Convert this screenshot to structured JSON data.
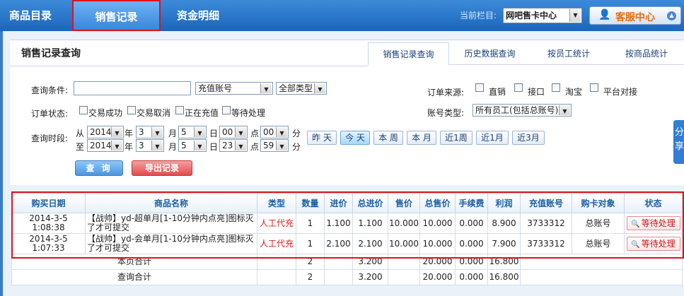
{
  "nav": {
    "items": [
      {
        "label": "商品目录",
        "active": false
      },
      {
        "label": "销售记录",
        "active": true
      },
      {
        "label": "资金明细",
        "active": false
      }
    ],
    "current_label": "当前栏目:",
    "current_value": "网吧售卡中心",
    "service_label": "客服中心"
  },
  "panel": {
    "title": "销售记录查询",
    "tabs": [
      {
        "label": "销售记录查询",
        "active": true
      },
      {
        "label": "历史数据查询",
        "active": false
      },
      {
        "label": "按员工统计",
        "active": false
      },
      {
        "label": "按商品统计",
        "active": false
      }
    ]
  },
  "filters": {
    "query_label": "查询条件:",
    "query_value": "",
    "account_type": "充值账号",
    "all_types": "全部类型",
    "order_source_label": "订单来源:",
    "order_sources": [
      "直销",
      "接口",
      "淘宝",
      "平台对接"
    ],
    "order_status_label": "订单状态:",
    "order_statuses": [
      "交易成功",
      "交易取消",
      "正在充值",
      "等待处理"
    ],
    "account_kind_label": "账号类型:",
    "account_kind_value": "所有员工(包括总账号)",
    "time_label": "查询时段:",
    "from": {
      "prefix": "从",
      "year": "2014",
      "month": "3",
      "day": "5",
      "hour": "00",
      "minute": "00"
    },
    "to": {
      "prefix": "至",
      "year": "2014",
      "month": "3",
      "day": "5",
      "hour": "23",
      "minute": "59"
    },
    "units": {
      "year": "年",
      "month": "月",
      "day": "日",
      "hour": "点",
      "minute": "分"
    },
    "quick_ranges": [
      {
        "label": "昨 天",
        "active": false
      },
      {
        "label": "今 天",
        "active": true
      },
      {
        "label": "本 周",
        "active": false
      },
      {
        "label": "本 月",
        "active": false
      },
      {
        "label": "近1周",
        "active": false
      },
      {
        "label": "近1月",
        "active": false
      },
      {
        "label": "近3月",
        "active": false
      }
    ],
    "query_button": "查 询",
    "export_button": "导出记录"
  },
  "share_tab": "分享",
  "table": {
    "headers": [
      "购买日期",
      "商品名称",
      "类型",
      "数量",
      "进价",
      "总进价",
      "售价",
      "总售价",
      "手续费",
      "利润",
      "充值账号",
      "购卡对象",
      "状态"
    ],
    "rows": [
      {
        "date": "2014-3-5 1:08:38",
        "name": "【战帅】yd-超单月[1-10分钟内点亮]图标灭了才可提交",
        "type": "人工代充",
        "qty": "1",
        "cost": "1.100",
        "total_cost": "1.100",
        "price": "10.000",
        "total_price": "10.000",
        "fee": "0.000",
        "profit": "8.900",
        "account": "3733312",
        "target": "总账号",
        "status": "等待处理"
      },
      {
        "date": "2014-3-5 1:07:33",
        "name": "【战帅】yd-会单月[1-10分钟内点亮]图标灭了才可提交",
        "type": "人工代充",
        "qty": "1",
        "cost": "2.100",
        "total_cost": "2.100",
        "price": "10.000",
        "total_price": "10.000",
        "fee": "0.000",
        "profit": "7.900",
        "account": "3733312",
        "target": "总账号",
        "status": "等待处理"
      }
    ],
    "summaries": [
      {
        "label": "本页合计",
        "qty": "2",
        "total_cost": "3.200",
        "total_price": "20.000",
        "fee": "0.000",
        "profit": "16.800"
      },
      {
        "label": "查询合计",
        "qty": "2",
        "total_cost": "3.200",
        "total_price": "20.000",
        "fee": "0.000",
        "profit": "16.800"
      }
    ]
  }
}
